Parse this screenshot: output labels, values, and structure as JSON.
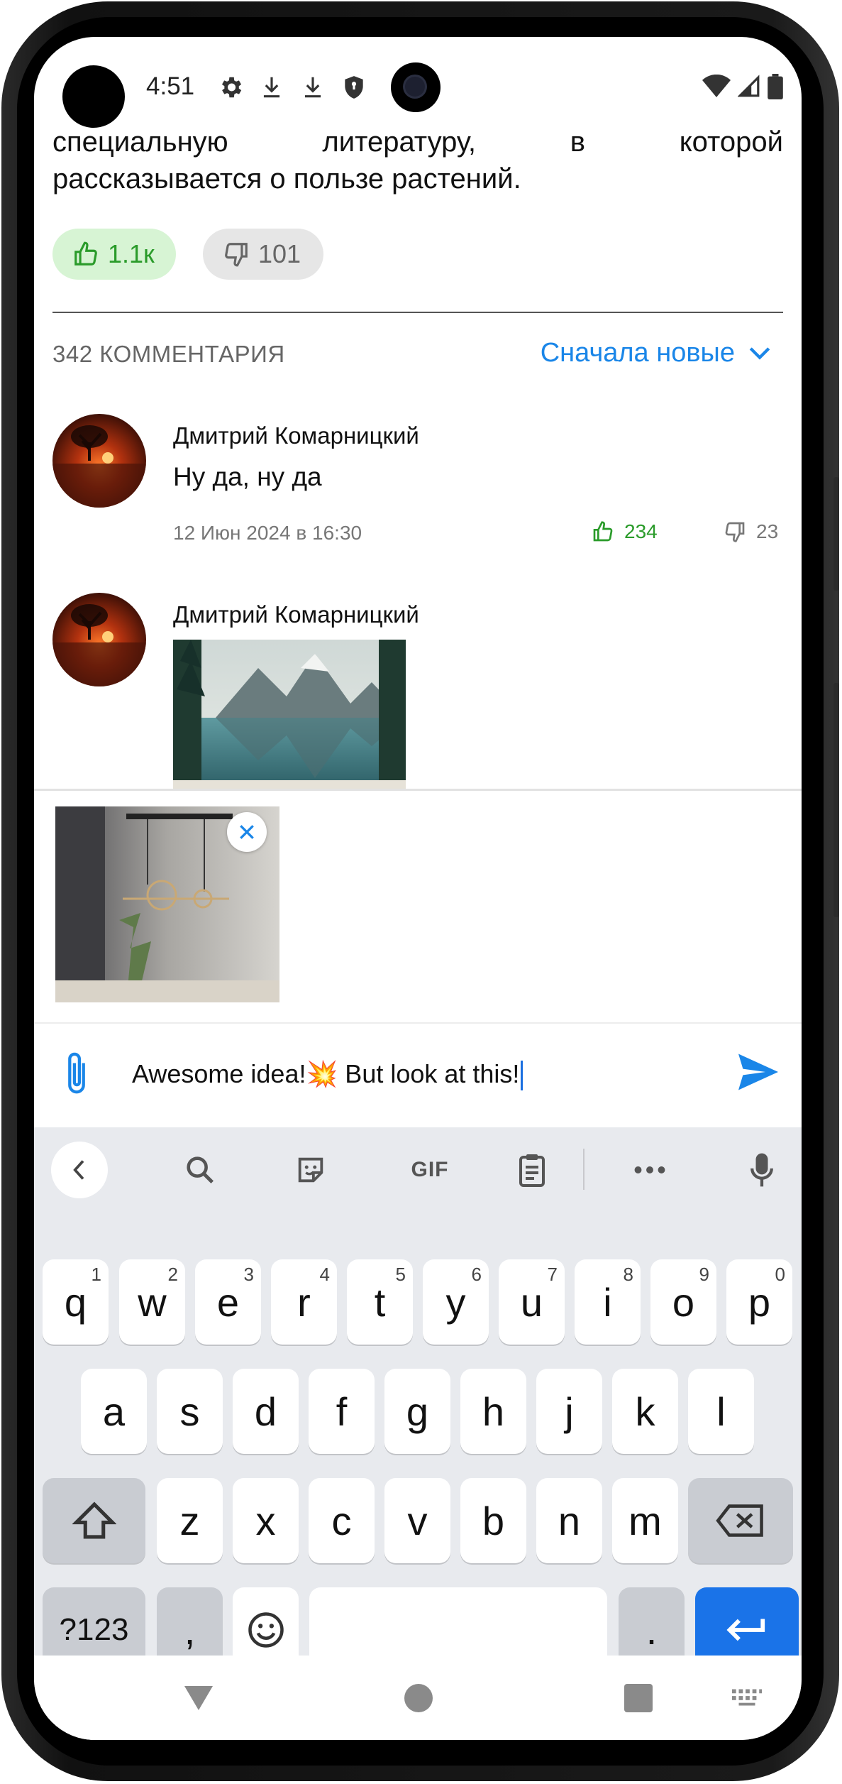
{
  "status_bar": {
    "time": "4:51",
    "icons": [
      "gear-icon",
      "download-icon",
      "download-icon",
      "shield-icon",
      "wifi-icon",
      "signal-icon",
      "battery-icon"
    ]
  },
  "article": {
    "line1": "специальную литературу, в которой",
    "line2": "рассказывается о пользе растений.",
    "likes": "1.1к",
    "dislikes": "101"
  },
  "comments_header": {
    "count_label": "342 КОММЕНТАРИЯ",
    "sort_label": "Сначала новые"
  },
  "comments": [
    {
      "author": "Дмитрий Комарницкий",
      "text": "Ну да, ну да",
      "date": "12 Июн 2024 в 16:30",
      "likes": "234",
      "dislikes": "23"
    },
    {
      "author": "Дмитрий Комарницкий",
      "image": "mountain-lake-image"
    }
  ],
  "attachment": {
    "image": "room-chandelier-image"
  },
  "composer": {
    "text": "Awesome idea!💥 But look at this!"
  },
  "keyboard": {
    "toolbar": [
      "chevron-left-icon",
      "search-icon",
      "sticker-icon",
      "GIF",
      "clipboard-icon",
      "more-icon",
      "mic-icon"
    ],
    "row1": [
      {
        "k": "q",
        "h": "1"
      },
      {
        "k": "w",
        "h": "2"
      },
      {
        "k": "e",
        "h": "3"
      },
      {
        "k": "r",
        "h": "4"
      },
      {
        "k": "t",
        "h": "5"
      },
      {
        "k": "y",
        "h": "6"
      },
      {
        "k": "u",
        "h": "7"
      },
      {
        "k": "i",
        "h": "8"
      },
      {
        "k": "o",
        "h": "9"
      },
      {
        "k": "p",
        "h": "0"
      }
    ],
    "row2": [
      "a",
      "s",
      "d",
      "f",
      "g",
      "h",
      "j",
      "k",
      "l"
    ],
    "row3": [
      "z",
      "x",
      "c",
      "v",
      "b",
      "n",
      "m"
    ],
    "symbols_label": "?123",
    "comma": ",",
    "period": "."
  },
  "colors": {
    "accent": "#1a86e8",
    "like_green": "#2a9b2a",
    "like_bg": "#d7f4d4",
    "keyboard_bg": "#e8eaee",
    "enter_key": "#1a73e8"
  }
}
